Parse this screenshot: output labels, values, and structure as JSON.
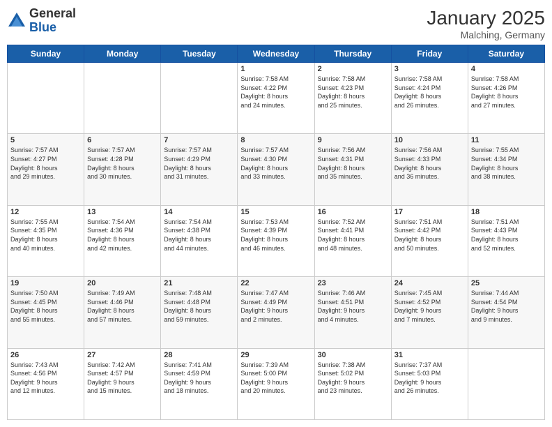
{
  "header": {
    "logo_general": "General",
    "logo_blue": "Blue",
    "month": "January 2025",
    "location": "Malching, Germany"
  },
  "days_of_week": [
    "Sunday",
    "Monday",
    "Tuesday",
    "Wednesday",
    "Thursday",
    "Friday",
    "Saturday"
  ],
  "weeks": [
    [
      {
        "day": "",
        "info": ""
      },
      {
        "day": "",
        "info": ""
      },
      {
        "day": "",
        "info": ""
      },
      {
        "day": "1",
        "info": "Sunrise: 7:58 AM\nSunset: 4:22 PM\nDaylight: 8 hours\nand 24 minutes."
      },
      {
        "day": "2",
        "info": "Sunrise: 7:58 AM\nSunset: 4:23 PM\nDaylight: 8 hours\nand 25 minutes."
      },
      {
        "day": "3",
        "info": "Sunrise: 7:58 AM\nSunset: 4:24 PM\nDaylight: 8 hours\nand 26 minutes."
      },
      {
        "day": "4",
        "info": "Sunrise: 7:58 AM\nSunset: 4:26 PM\nDaylight: 8 hours\nand 27 minutes."
      }
    ],
    [
      {
        "day": "5",
        "info": "Sunrise: 7:57 AM\nSunset: 4:27 PM\nDaylight: 8 hours\nand 29 minutes."
      },
      {
        "day": "6",
        "info": "Sunrise: 7:57 AM\nSunset: 4:28 PM\nDaylight: 8 hours\nand 30 minutes."
      },
      {
        "day": "7",
        "info": "Sunrise: 7:57 AM\nSunset: 4:29 PM\nDaylight: 8 hours\nand 31 minutes."
      },
      {
        "day": "8",
        "info": "Sunrise: 7:57 AM\nSunset: 4:30 PM\nDaylight: 8 hours\nand 33 minutes."
      },
      {
        "day": "9",
        "info": "Sunrise: 7:56 AM\nSunset: 4:31 PM\nDaylight: 8 hours\nand 35 minutes."
      },
      {
        "day": "10",
        "info": "Sunrise: 7:56 AM\nSunset: 4:33 PM\nDaylight: 8 hours\nand 36 minutes."
      },
      {
        "day": "11",
        "info": "Sunrise: 7:55 AM\nSunset: 4:34 PM\nDaylight: 8 hours\nand 38 minutes."
      }
    ],
    [
      {
        "day": "12",
        "info": "Sunrise: 7:55 AM\nSunset: 4:35 PM\nDaylight: 8 hours\nand 40 minutes."
      },
      {
        "day": "13",
        "info": "Sunrise: 7:54 AM\nSunset: 4:36 PM\nDaylight: 8 hours\nand 42 minutes."
      },
      {
        "day": "14",
        "info": "Sunrise: 7:54 AM\nSunset: 4:38 PM\nDaylight: 8 hours\nand 44 minutes."
      },
      {
        "day": "15",
        "info": "Sunrise: 7:53 AM\nSunset: 4:39 PM\nDaylight: 8 hours\nand 46 minutes."
      },
      {
        "day": "16",
        "info": "Sunrise: 7:52 AM\nSunset: 4:41 PM\nDaylight: 8 hours\nand 48 minutes."
      },
      {
        "day": "17",
        "info": "Sunrise: 7:51 AM\nSunset: 4:42 PM\nDaylight: 8 hours\nand 50 minutes."
      },
      {
        "day": "18",
        "info": "Sunrise: 7:51 AM\nSunset: 4:43 PM\nDaylight: 8 hours\nand 52 minutes."
      }
    ],
    [
      {
        "day": "19",
        "info": "Sunrise: 7:50 AM\nSunset: 4:45 PM\nDaylight: 8 hours\nand 55 minutes."
      },
      {
        "day": "20",
        "info": "Sunrise: 7:49 AM\nSunset: 4:46 PM\nDaylight: 8 hours\nand 57 minutes."
      },
      {
        "day": "21",
        "info": "Sunrise: 7:48 AM\nSunset: 4:48 PM\nDaylight: 8 hours\nand 59 minutes."
      },
      {
        "day": "22",
        "info": "Sunrise: 7:47 AM\nSunset: 4:49 PM\nDaylight: 9 hours\nand 2 minutes."
      },
      {
        "day": "23",
        "info": "Sunrise: 7:46 AM\nSunset: 4:51 PM\nDaylight: 9 hours\nand 4 minutes."
      },
      {
        "day": "24",
        "info": "Sunrise: 7:45 AM\nSunset: 4:52 PM\nDaylight: 9 hours\nand 7 minutes."
      },
      {
        "day": "25",
        "info": "Sunrise: 7:44 AM\nSunset: 4:54 PM\nDaylight: 9 hours\nand 9 minutes."
      }
    ],
    [
      {
        "day": "26",
        "info": "Sunrise: 7:43 AM\nSunset: 4:56 PM\nDaylight: 9 hours\nand 12 minutes."
      },
      {
        "day": "27",
        "info": "Sunrise: 7:42 AM\nSunset: 4:57 PM\nDaylight: 9 hours\nand 15 minutes."
      },
      {
        "day": "28",
        "info": "Sunrise: 7:41 AM\nSunset: 4:59 PM\nDaylight: 9 hours\nand 18 minutes."
      },
      {
        "day": "29",
        "info": "Sunrise: 7:39 AM\nSunset: 5:00 PM\nDaylight: 9 hours\nand 20 minutes."
      },
      {
        "day": "30",
        "info": "Sunrise: 7:38 AM\nSunset: 5:02 PM\nDaylight: 9 hours\nand 23 minutes."
      },
      {
        "day": "31",
        "info": "Sunrise: 7:37 AM\nSunset: 5:03 PM\nDaylight: 9 hours\nand 26 minutes."
      },
      {
        "day": "",
        "info": ""
      }
    ]
  ]
}
